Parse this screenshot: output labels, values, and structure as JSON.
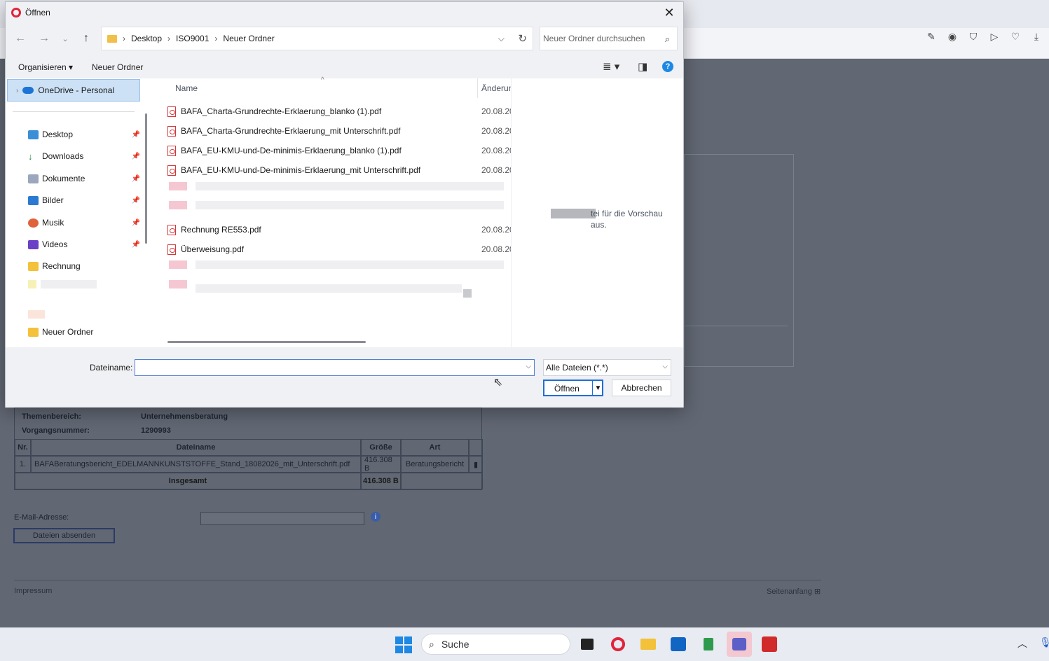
{
  "dialog": {
    "title": "Öffnen",
    "breadcrumb": [
      "Desktop",
      "ISO9001",
      "Neuer Ordner"
    ],
    "search_placeholder": "Neuer Ordner durchsuchen",
    "organize": "Organisieren",
    "organize_arrow": "▾",
    "new_folder": "Neuer Ordner",
    "columns": {
      "name": "Name",
      "modified": "Änderun"
    },
    "nav": {
      "onedrive": "OneDrive - Personal",
      "items": [
        {
          "label": "Desktop",
          "icon": "desktop-icon",
          "pinned": true
        },
        {
          "label": "Downloads",
          "icon": "download-icon",
          "pinned": true
        },
        {
          "label": "Dokumente",
          "icon": "document-icon",
          "pinned": true
        },
        {
          "label": "Bilder",
          "icon": "pictures-icon",
          "pinned": true
        },
        {
          "label": "Musik",
          "icon": "music-icon",
          "pinned": true
        },
        {
          "label": "Videos",
          "icon": "videos-icon",
          "pinned": true
        },
        {
          "label": "Rechnung",
          "icon": "folder-icon",
          "pinned": false
        },
        {
          "label": "Neuer Ordner",
          "icon": "folder-icon",
          "pinned": false
        }
      ]
    },
    "files": [
      {
        "name": "BAFA_Charta-Grundrechte-Erklaerung_blanko (1).pdf",
        "date": "20.08.20"
      },
      {
        "name": "BAFA_Charta-Grundrechte-Erklaerung_mit Unterschrift.pdf",
        "date": "20.08.20"
      },
      {
        "name": "BAFA_EU-KMU-und-De-minimis-Erklaerung_blanko (1).pdf",
        "date": "20.08.20"
      },
      {
        "name": "BAFA_EU-KMU-und-De-minimis-Erklaerung_mit Unterschrift.pdf",
        "date": "20.08.20"
      },
      {
        "name": "Rechnung RE553.pdf",
        "date": "20.08.20"
      },
      {
        "name": "Überweisung.pdf",
        "date": "20.08.20"
      }
    ],
    "preview_text": "tei für die Vorschau aus.",
    "filename_label": "Dateiname:",
    "filename_value": "",
    "filetype": "Alle Dateien (*.*)",
    "open_label": "Öffnen",
    "cancel_label": "Abbrechen"
  },
  "background": {
    "meta": [
      {
        "label": "Themenbereich:",
        "value": "Unternehmensberatung"
      },
      {
        "label": "Vorgangsnummer:",
        "value": "1290993"
      }
    ],
    "table_headers": [
      "Nr.",
      "Dateiname",
      "Größe",
      "Art"
    ],
    "rows": [
      {
        "nr": "1.",
        "name": "BAFABeratungsbericht_EDELMANNKUNSTSTOFFE_Stand_18082026_mit_Unterschrift.pdf",
        "size": "416.308 B",
        "type": "Beratungsbericht"
      }
    ],
    "total_label": "Insgesamt",
    "total_size": "416.308 B",
    "email_label": "E-Mail-Adresse:",
    "send_button": "Dateien absenden",
    "impressum": "Impressum",
    "seitenanfang": "Seitenanfang"
  },
  "taskbar": {
    "search_label": "Suche"
  }
}
